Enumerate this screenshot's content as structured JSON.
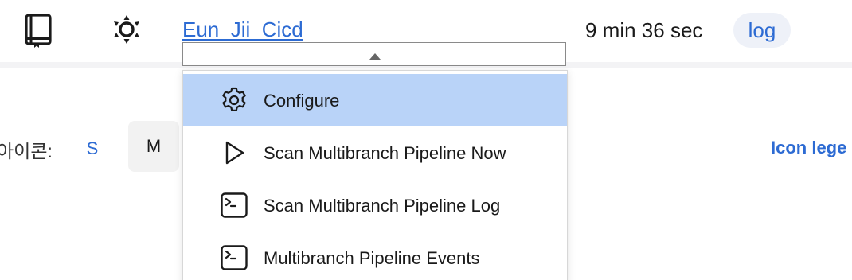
{
  "header": {
    "job_name": "Eun_Jii_Cicd",
    "duration": "9 min 36 sec",
    "log_label": "log",
    "icons": [
      "notebook-icon",
      "sun-settings-icon"
    ]
  },
  "icon_size": {
    "label": "아이콘:",
    "options": [
      "S",
      "M"
    ],
    "selected": "M"
  },
  "legend_link": "Icon lege",
  "dropdown": {
    "items": [
      {
        "label": "Configure",
        "icon": "gear-icon",
        "active": true
      },
      {
        "label": "Scan Multibranch Pipeline Now",
        "icon": "play-icon",
        "active": false
      },
      {
        "label": "Scan Multibranch Pipeline Log",
        "icon": "terminal-icon",
        "active": false
      },
      {
        "label": "Multibranch Pipeline Events",
        "icon": "terminal-icon",
        "active": false
      }
    ]
  },
  "colors": {
    "link": "#2d6bd3",
    "active_item": "#b9d3f8",
    "log_bg": "#eef1f8"
  }
}
